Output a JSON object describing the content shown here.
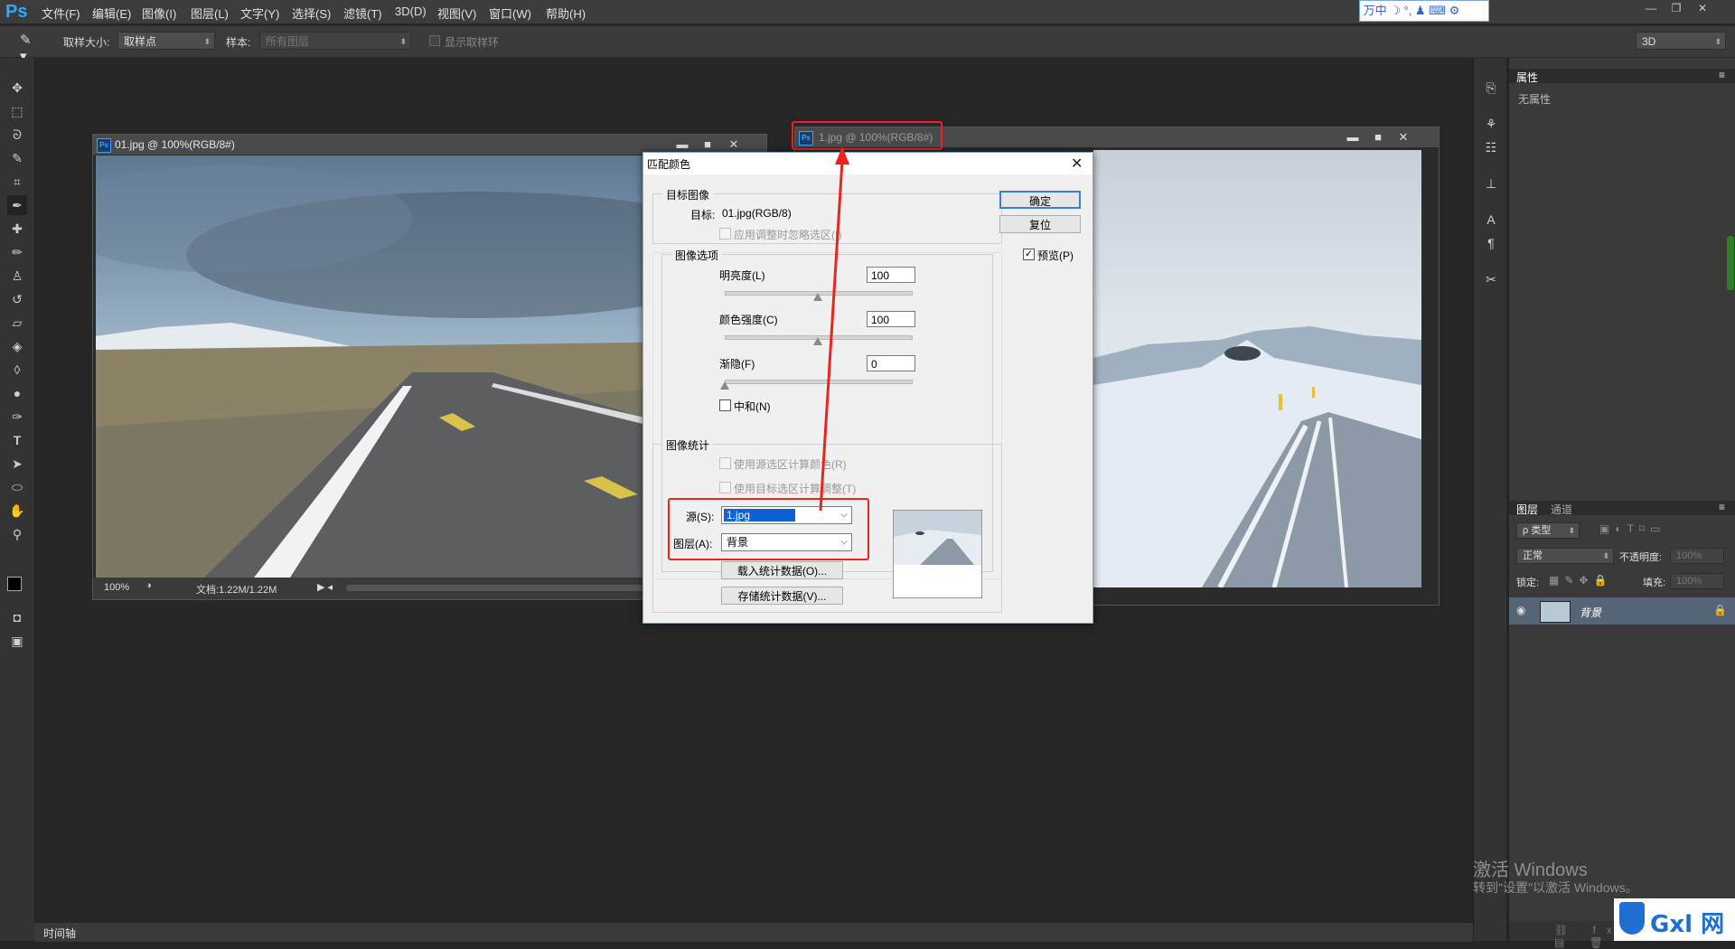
{
  "app": {
    "logo": "Ps"
  },
  "menu": [
    "文件(F)",
    "编辑(E)",
    "图像(I)",
    "图层(L)",
    "文字(Y)",
    "选择(S)",
    "滤镜(T)",
    "3D(D)",
    "视图(V)",
    "窗口(W)",
    "帮助(H)"
  ],
  "ime": "万中 ☽ °, ♟ ⌨ ⚙",
  "options": {
    "sample_size_label": "取样大小:",
    "sample_size_value": "取样点",
    "sample_label": "样本:",
    "sample_value": "所有图层",
    "show_ring_label": "显示取样环",
    "workspace": "3D"
  },
  "doc1": {
    "title": "01.jpg @ 100%(RGB/8#)",
    "zoom": "100%",
    "docsize": "文档:1.22M/1.22M"
  },
  "doc2": {
    "title": "1.jpg @ 100%(RGB/8#)"
  },
  "dialog": {
    "title": "匹配颜色",
    "target_group": "目标图像",
    "target_label": "目标:",
    "target_value": "01.jpg(RGB/8)",
    "ignore_selection": "应用调整时忽略选区(I)",
    "options_group": "图像选项",
    "luminance_label": "明亮度(L)",
    "luminance_value": "100",
    "luminance_pct": 50,
    "intensity_label": "颜色强度(C)",
    "intensity_value": "100",
    "intensity_pct": 50,
    "fade_label": "渐隐(F)",
    "fade_value": "0",
    "fade_pct": 0,
    "neutralize": "中和(N)",
    "stats_group": "图像统计",
    "use_source_sel": "使用源选区计算颜色(R)",
    "use_target_sel": "使用目标选区计算调整(T)",
    "source_label": "源(S):",
    "source_value": "1.jpg",
    "layer_label": "图层(A):",
    "layer_value": "背景",
    "load_stats": "载入统计数据(O)...",
    "save_stats": "存储统计数据(V)...",
    "ok": "确定",
    "reset": "复位",
    "preview": "预览(P)",
    "preview_checked": true
  },
  "properties": {
    "tab": "属性",
    "empty": "无属性"
  },
  "layers": {
    "tab_layers": "图层",
    "tab_channels": "通道",
    "filter_kind": "ρ 类型",
    "blend_mode": "正常",
    "opacity_label": "不透明度:",
    "opacity_value": "100%",
    "lock_label": "锁定:",
    "fill_label": "填充:",
    "fill_value": "100%",
    "layer_name": "背景"
  },
  "timeline": {
    "label": "时间轴"
  },
  "watermark": {
    "line1": "激活 Windows",
    "line2": "转到\"设置\"以激活 Windows。"
  },
  "site_logo": "Gxl 网"
}
